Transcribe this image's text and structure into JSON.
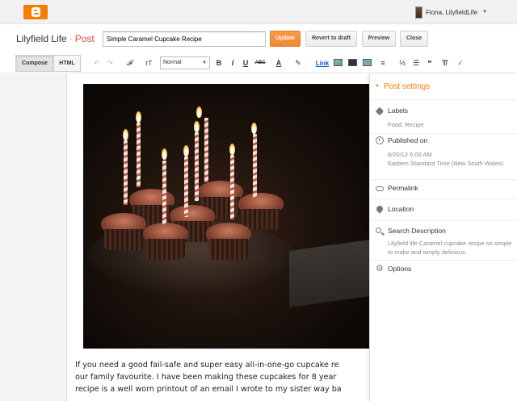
{
  "topbar": {
    "user_name": "Fiona, LilyfieldLife",
    "user_caret": "▼"
  },
  "header": {
    "blog_name": "Lilyfield Life",
    "separator": "·",
    "section": "Post",
    "post_title": "Simple Caramel Cupcake Recipe",
    "buttons": {
      "update": "Update",
      "revert": "Revert to draft",
      "preview": "Preview",
      "close": "Close"
    }
  },
  "toolbar": {
    "compose": "Compose",
    "html": "HTML",
    "undo": "↶",
    "redo": "↷",
    "font_icon": "𝓕",
    "font_size_icon": "тT",
    "format_value": "Normal",
    "bold": "B",
    "italic": "I",
    "underline": "U",
    "strike": "ABC",
    "text_color": "A",
    "highlight": "✎",
    "link": "Link",
    "align": "≡",
    "numbered_list": "⅓",
    "bullet_list": "☰",
    "quote": "❝",
    "clear_format": "T̸"
  },
  "editor": {
    "body_lines": [
      "If you need a good fail-safe and super easy all-in-one-go cupcake re",
      "our family favourite.  I have been making these cupcakes for 8 year",
      "recipe is a well worn printout of an email I wrote to my sister way ba"
    ]
  },
  "sidebar": {
    "title": "Post settings",
    "labels": {
      "label": "Labels",
      "value": "Food, Recipe"
    },
    "published": {
      "label": "Published on",
      "date": "8/20/12 6:00 AM",
      "timezone": "Eastern Standard Time (New South Wales)"
    },
    "permalink": {
      "label": "Permalink"
    },
    "location": {
      "label": "Location"
    },
    "search_description": {
      "label": "Search Description",
      "value": "Lilyfield life Caramel cupcake recipe so simple to make and simply delicious."
    },
    "options": {
      "label": "Options"
    }
  },
  "colors": {
    "brand_orange": "#f57d00",
    "update_button": "#f08a33",
    "post_red": "#dd4b39"
  }
}
